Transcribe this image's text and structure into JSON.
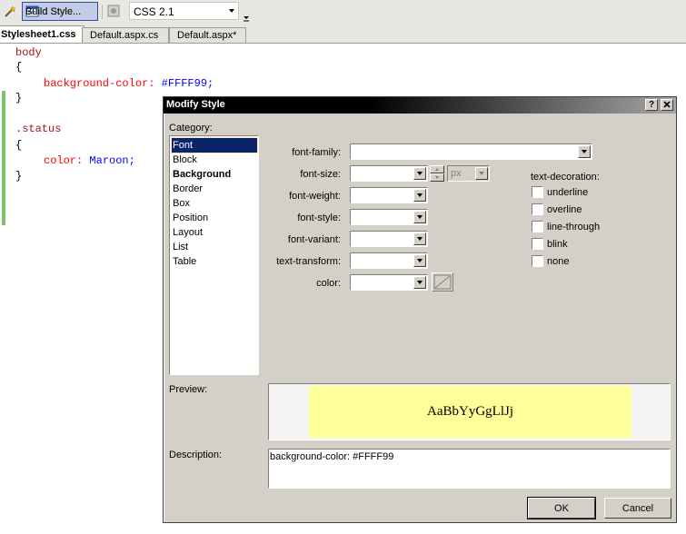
{
  "toolbar": {
    "build_style_label": "Build Style...",
    "css_version": "CSS 2.1"
  },
  "tabs": [
    {
      "label": "Stylesheet1.css",
      "active": true
    },
    {
      "label": "Default.aspx.cs",
      "active": false
    },
    {
      "label": "Default.aspx*",
      "active": false
    }
  ],
  "code": {
    "body_selector": "body",
    "open_brace": "{",
    "close_brace": "}",
    "bg_prop": "background-color:",
    "bg_value": "#FFFF99;",
    "status_selector": ".status",
    "color_prop": "color:",
    "color_value": "Maroon;"
  },
  "dialog": {
    "title": "Modify Style",
    "help_button": "?",
    "close_button": "X",
    "category_label": "Category:",
    "categories": [
      "Font",
      "Block",
      "Background",
      "Border",
      "Box",
      "Position",
      "Layout",
      "List",
      "Table"
    ],
    "selected_category": "Font",
    "bold_category": "Background",
    "fields": {
      "font_family": "font-family:",
      "font_size": "font-size:",
      "font_weight": "font-weight:",
      "font_style": "font-style:",
      "font_variant": "font-variant:",
      "text_transform": "text-transform:",
      "color": "color:"
    },
    "size_unit": "px",
    "text_decoration_label": "text-decoration:",
    "decorations": [
      "underline",
      "overline",
      "line-through",
      "blink",
      "none"
    ],
    "preview_label": "Preview:",
    "preview_text": "AaBbYyGgLlJj",
    "preview_bg": "#FFFF99",
    "description_label": "Description:",
    "description_text": "background-color: #FFFF99",
    "ok_label": "OK",
    "cancel_label": "Cancel"
  }
}
